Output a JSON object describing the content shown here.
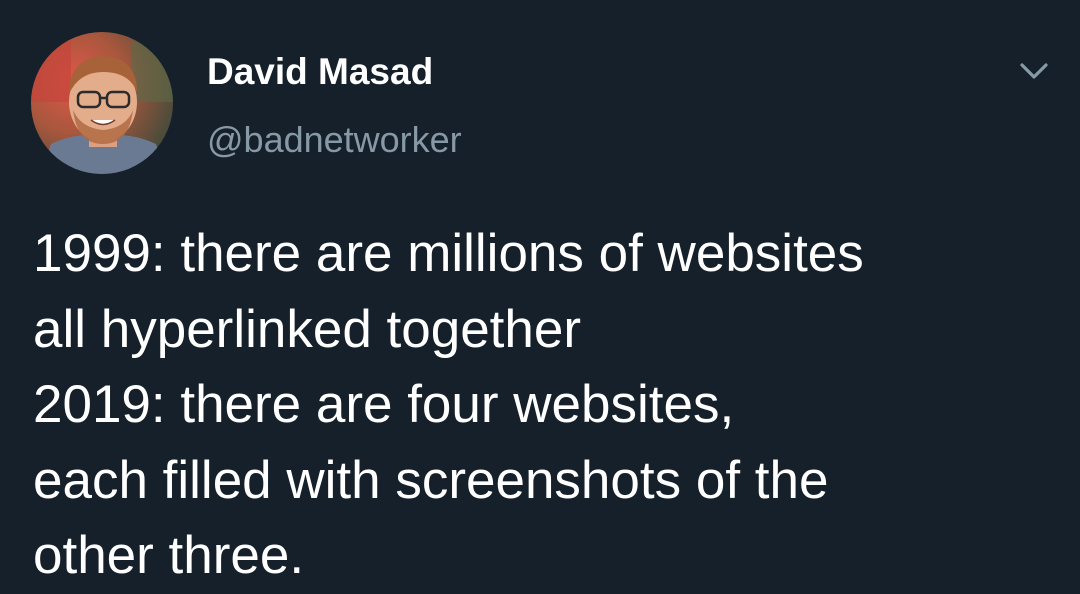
{
  "tweet": {
    "author_name": "David Masad",
    "author_handle": "@badnetworker",
    "menu_icon": "chevron-down-icon",
    "avatar_icon": "avatar-photo",
    "lines": [
      "1999: there are millions of websites",
      "all hyperlinked together",
      "2019: there are four websites,",
      "each filled with screenshots of the",
      "other three."
    ]
  },
  "colors": {
    "background": "#15202b",
    "text": "#ffffff",
    "secondary_text": "#8899a6"
  }
}
